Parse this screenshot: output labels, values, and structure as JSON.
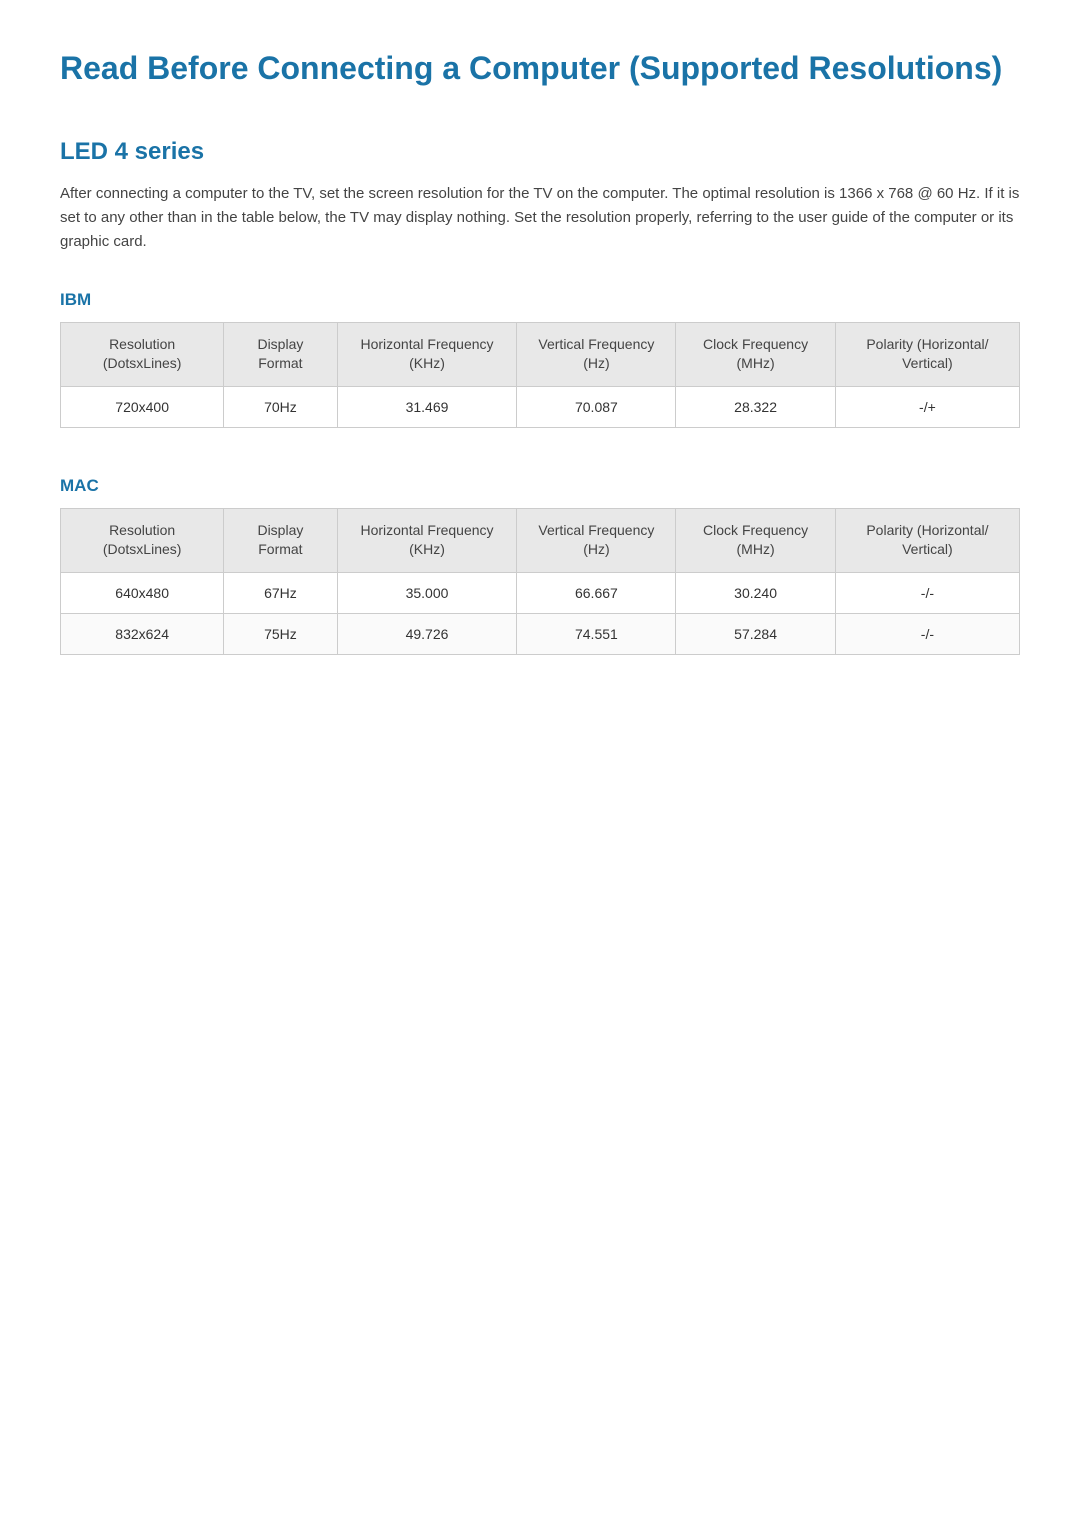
{
  "page": {
    "title": "Read Before Connecting a Computer (Supported Resolutions)"
  },
  "led4series": {
    "title": "LED 4 series",
    "description": "After connecting a computer to the TV, set the screen resolution for the TV on the computer. The optimal resolution is 1366 x 768 @ 60 Hz. If it is set to any other than in the table below, the TV may display nothing. Set the resolution properly, referring to the user guide of the computer or its graphic card."
  },
  "ibm": {
    "subsectionTitle": "IBM",
    "columns": {
      "resolution": "Resolution (DotsxLines)",
      "displayFormat": "Display Format",
      "horizontalFreq": "Horizontal Frequency (KHz)",
      "verticalFreq": "Vertical Frequency (Hz)",
      "clockFreq": "Clock Frequency (MHz)",
      "polarity": "Polarity (Horizontal/ Vertical)"
    },
    "rows": [
      {
        "resolution": "720x400",
        "displayFormat": "70Hz",
        "horizontalFreq": "31.469",
        "verticalFreq": "70.087",
        "clockFreq": "28.322",
        "polarity": "-/+"
      }
    ]
  },
  "mac": {
    "subsectionTitle": "MAC",
    "columns": {
      "resolution": "Resolution (DotsxLines)",
      "displayFormat": "Display Format",
      "horizontalFreq": "Horizontal Frequency (KHz)",
      "verticalFreq": "Vertical Frequency (Hz)",
      "clockFreq": "Clock Frequency (MHz)",
      "polarity": "Polarity (Horizontal/ Vertical)"
    },
    "rows": [
      {
        "resolution": "640x480",
        "displayFormat": "67Hz",
        "horizontalFreq": "35.000",
        "verticalFreq": "66.667",
        "clockFreq": "30.240",
        "polarity": "-/-"
      },
      {
        "resolution": "832x624",
        "displayFormat": "75Hz",
        "horizontalFreq": "49.726",
        "verticalFreq": "74.551",
        "clockFreq": "57.284",
        "polarity": "-/-"
      }
    ]
  }
}
